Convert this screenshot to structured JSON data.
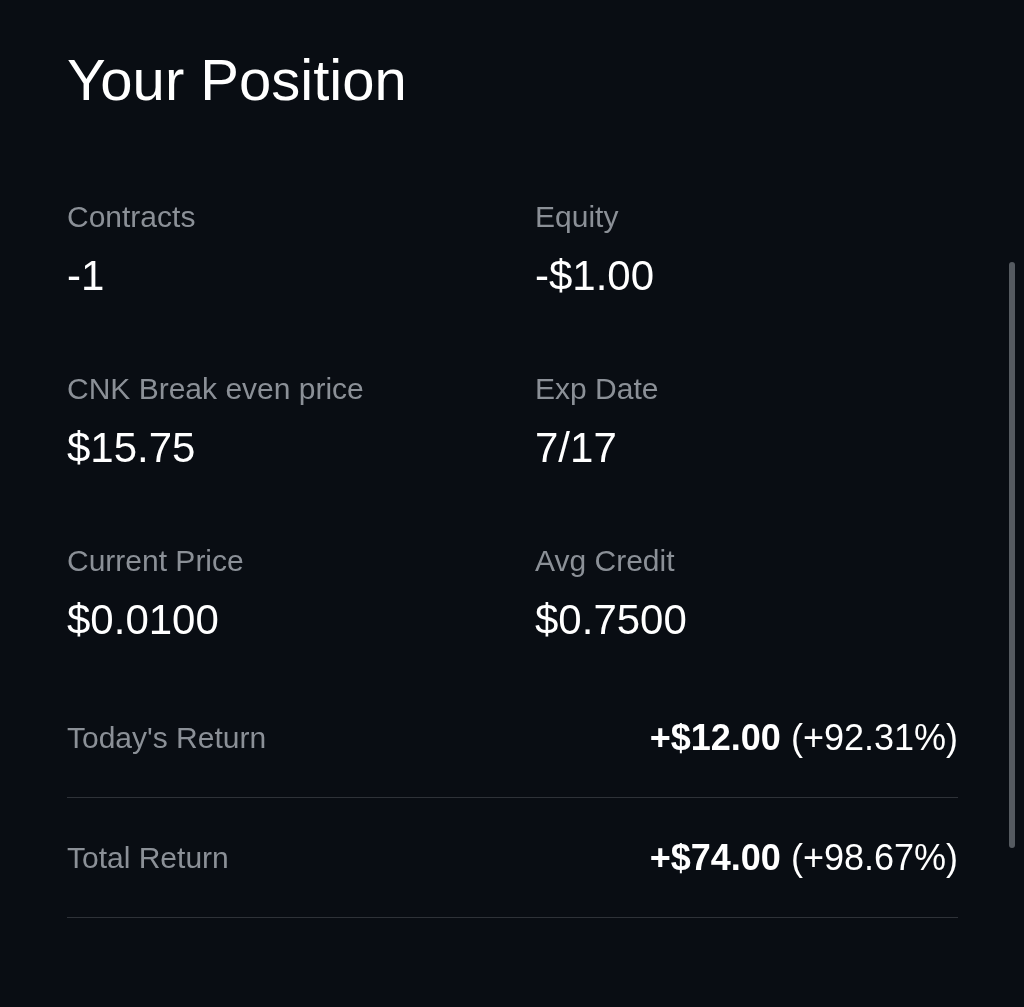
{
  "title": "Your Position",
  "stats": [
    {
      "label": "Contracts",
      "value": "-1"
    },
    {
      "label": "Equity",
      "value": "-$1.00"
    },
    {
      "label": "CNK Break even price",
      "value": "$15.75"
    },
    {
      "label": "Exp Date",
      "value": "7/17"
    },
    {
      "label": "Current Price",
      "value": "$0.0100"
    },
    {
      "label": "Avg Credit",
      "value": "$0.7500"
    }
  ],
  "returns": [
    {
      "label": "Today's Return",
      "value": "**+$12.00** (+92.31%)"
    },
    {
      "label": "Total Return",
      "value": "**+$74.00** (+98.67%)"
    }
  ]
}
